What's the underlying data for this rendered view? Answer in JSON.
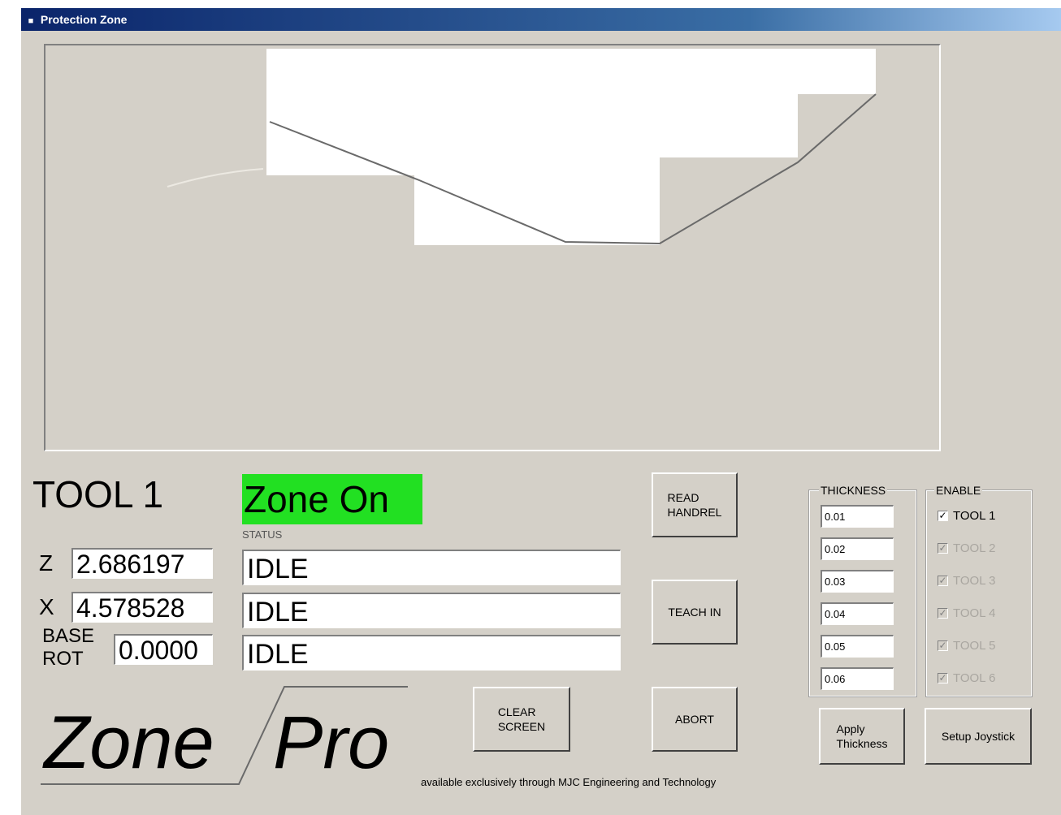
{
  "window": {
    "title": "Protection Zone",
    "title_icon": "app-icon"
  },
  "tool": {
    "label": "TOOL 1"
  },
  "zone": {
    "status_text": "Zone On",
    "status_color": "#22e022",
    "caption": "STATUS"
  },
  "coords": {
    "z_label": "Z",
    "z_value": "2.686197",
    "x_label": "X",
    "x_value": "4.578528",
    "base_rot_label": "BASE\nROT",
    "base_rot_value": "0.0000"
  },
  "status_fields": [
    "IDLE",
    "IDLE",
    "IDLE"
  ],
  "buttons": {
    "read_handrel": "READ\nHANDREL",
    "teach_in": "TEACH IN",
    "abort": "ABORT",
    "clear_screen": "CLEAR\nSCREEN",
    "apply_thickness": "Apply\nThickness",
    "setup_joystick": "Setup Joystick"
  },
  "thickness": {
    "title": "THICKNESS",
    "values": [
      "0.01",
      "0.02",
      "0.03",
      "0.04",
      "0.05",
      "0.06"
    ]
  },
  "enable": {
    "title": "ENABLE",
    "tools": [
      {
        "label": "TOOL 1",
        "checked": true,
        "enabled": true
      },
      {
        "label": "TOOL 2",
        "checked": true,
        "enabled": false
      },
      {
        "label": "TOOL 3",
        "checked": true,
        "enabled": false
      },
      {
        "label": "TOOL 4",
        "checked": true,
        "enabled": false
      },
      {
        "label": "TOOL 5",
        "checked": true,
        "enabled": false
      },
      {
        "label": "TOOL 6",
        "checked": true,
        "enabled": false
      }
    ]
  },
  "logo": {
    "word1": "Zone",
    "word2": "Pro"
  },
  "footer": "available exclusively through MJC Engineering and Technology"
}
